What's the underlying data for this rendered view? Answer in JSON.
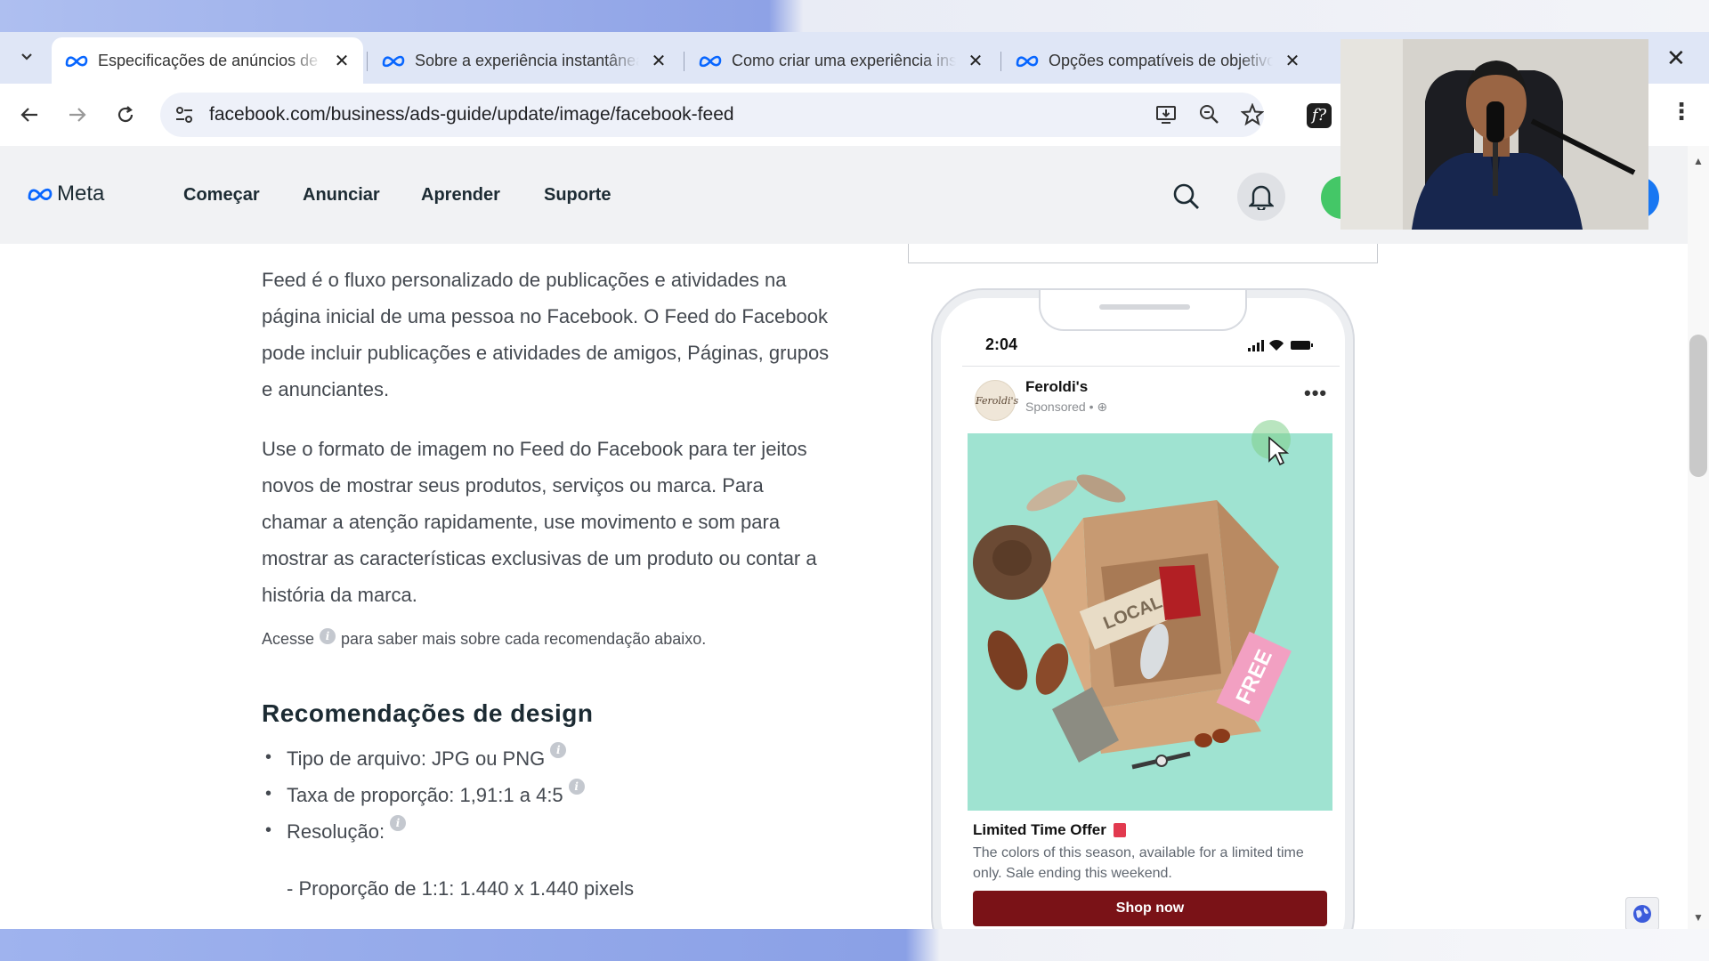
{
  "tabs": [
    {
      "title": "Especificações de anúncios de c",
      "active": true
    },
    {
      "title": "Sobre a experiência instantânea",
      "active": false
    },
    {
      "title": "Como criar uma experiência ins",
      "active": false
    },
    {
      "title": "Opções compatíveis de objetivo",
      "active": false
    }
  ],
  "address_bar": {
    "url": "facebook.com/business/ads-guide/update/image/facebook-feed"
  },
  "site_header": {
    "brand": "Meta",
    "nav": [
      "Começar",
      "Anunciar",
      "Aprender",
      "Suporte"
    ]
  },
  "article": {
    "paragraph_1": "Feed é o fluxo personalizado de publicações e atividades na página inicial de uma pessoa no Facebook. O Feed do Facebook pode incluir publicações e atividades de amigos, Páginas, grupos e anunciantes.",
    "paragraph_2": "Use o formato de imagem no Feed do Facebook para ter jeitos novos de mostrar seus produtos, serviços ou marca. Para chamar a atenção rapidamente, use movimento e som para mostrar as características exclusivas de um produto ou contar a história da marca.",
    "note_before": "Acesse",
    "note_after": "para saber mais sobre cada recomendação abaixo.",
    "section_title": "Recomendações de design",
    "design_items": [
      "Tipo de arquivo: JPG ou PNG",
      "Taxa de proporção: 1,91:1 a 4:5",
      "Resolução:"
    ],
    "sub_item": "- Proporção de 1:1: 1.440 x 1.440 pixels"
  },
  "preview": {
    "time": "2:04",
    "page_name": "Feroldi's",
    "sponsored": "Sponsored •",
    "avatar_text": "Feroldi's",
    "headline": "Limited Time Offer",
    "description": "The colors of this season, available for a limited time only. Sale ending this weekend.",
    "cta": "Shop now",
    "box_label": "LOCAL",
    "tag_label": "FREE"
  },
  "colors": {
    "accent": "#1877f2",
    "cta_bg": "#7a1217",
    "ad_bg": "#9fe3d1",
    "header_bg": "#f1f2f4"
  }
}
